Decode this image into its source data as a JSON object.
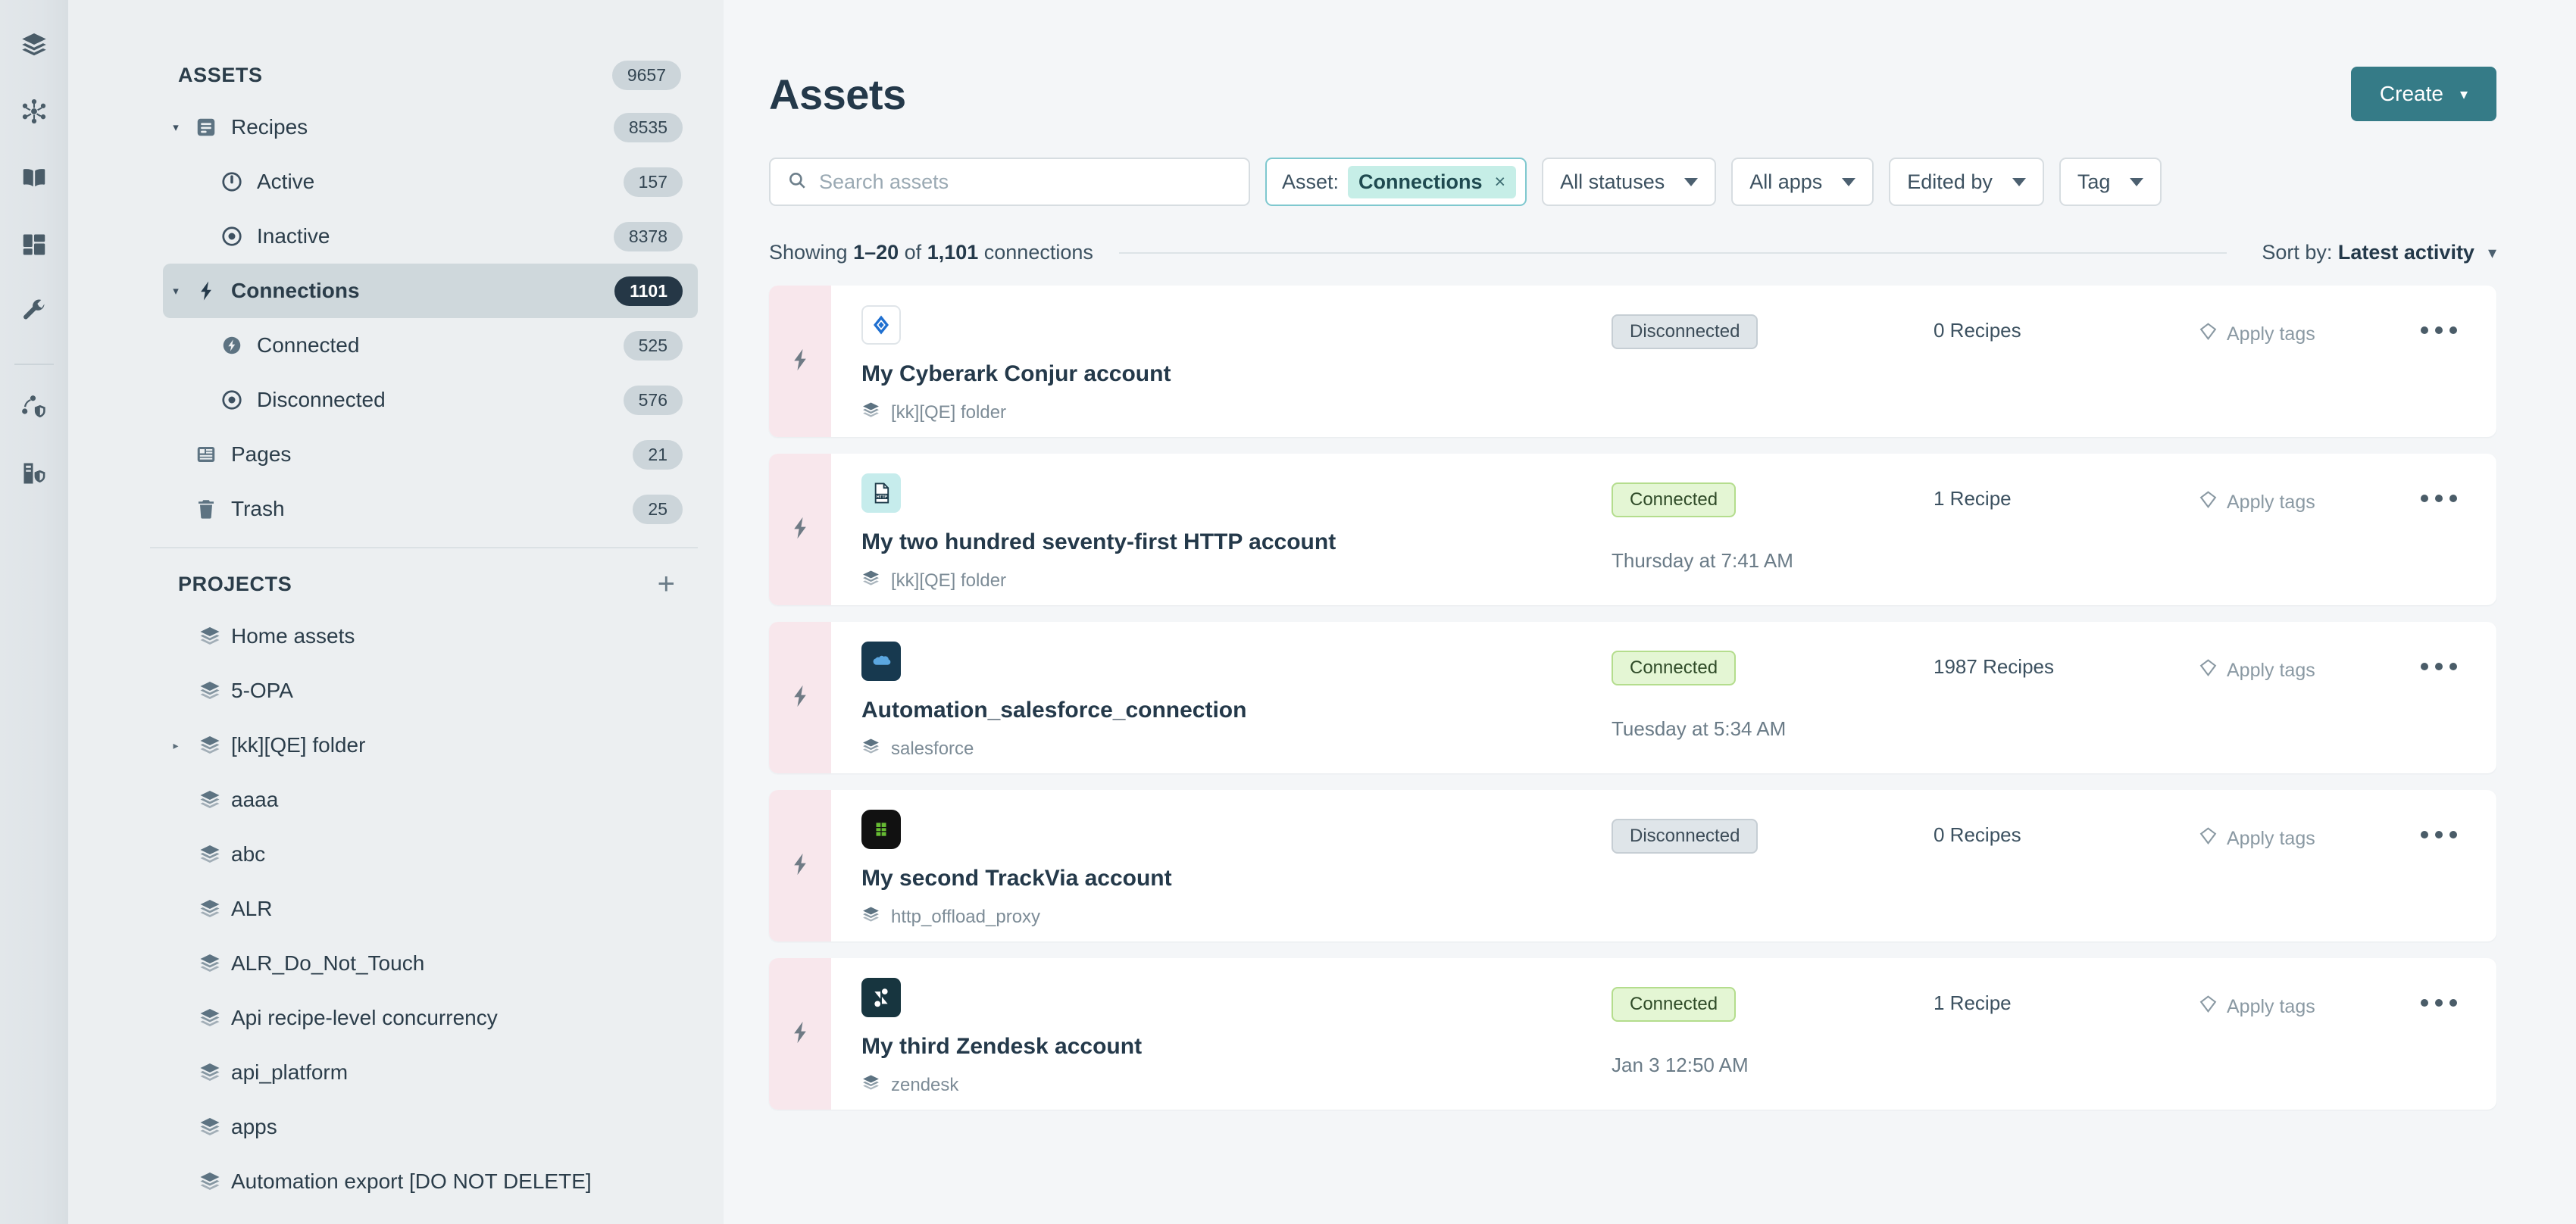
{
  "rail": {
    "items": [
      {
        "icon": "layers-icon",
        "name": "rail-item-assets"
      },
      {
        "icon": "hub-network-icon",
        "name": "rail-item-platform"
      },
      {
        "icon": "book-icon",
        "name": "rail-item-docs"
      },
      {
        "icon": "dashboard-icon",
        "name": "rail-item-dashboard"
      },
      {
        "icon": "wrench-icon",
        "name": "rail-item-tools"
      },
      {
        "icon": "network-shield-icon",
        "name": "rail-item-network-security"
      },
      {
        "icon": "server-shield-icon",
        "name": "rail-item-server-security"
      }
    ]
  },
  "sidebar": {
    "assets": {
      "title": "ASSETS",
      "count": "9657",
      "items": [
        {
          "label": "Recipes",
          "count": "8535",
          "icon": "recipe-icon",
          "level": 1,
          "caret": "down",
          "active": false
        },
        {
          "label": "Active",
          "count": "157",
          "icon": "power-icon",
          "level": 2,
          "caret": "none",
          "active": false
        },
        {
          "label": "Inactive",
          "count": "8378",
          "icon": "inactive-icon",
          "level": 2,
          "caret": "none",
          "active": false
        },
        {
          "label": "Connections",
          "count": "1101",
          "icon": "bolt-icon",
          "level": 1,
          "caret": "down",
          "active": true
        },
        {
          "label": "Connected",
          "count": "525",
          "icon": "bolt-circle-icon",
          "level": 2,
          "caret": "none",
          "active": false
        },
        {
          "label": "Disconnected",
          "count": "576",
          "icon": "inactive-icon",
          "level": 2,
          "caret": "none",
          "active": false
        },
        {
          "label": "Pages",
          "count": "21",
          "icon": "pages-icon",
          "level": 1,
          "caret": "none",
          "active": false
        },
        {
          "label": "Trash",
          "count": "25",
          "icon": "trash-icon",
          "level": 1,
          "caret": "none",
          "active": false
        }
      ]
    },
    "projects": {
      "title": "PROJECTS",
      "add_label": "+",
      "items": [
        {
          "label": "Home assets",
          "caret": false
        },
        {
          "label": "5-OPA",
          "caret": false
        },
        {
          "label": "[kk][QE] folder",
          "caret": true
        },
        {
          "label": "aaaa",
          "caret": false
        },
        {
          "label": "abc",
          "caret": false
        },
        {
          "label": "ALR",
          "caret": false
        },
        {
          "label": "ALR_Do_Not_Touch",
          "caret": false
        },
        {
          "label": "Api recipe-level concurrency",
          "caret": false
        },
        {
          "label": "api_platform",
          "caret": false
        },
        {
          "label": "apps",
          "caret": false
        },
        {
          "label": "Automation export [DO NOT DELETE]",
          "caret": false
        }
      ]
    }
  },
  "main": {
    "page_title": "Assets",
    "create_button": "Create",
    "search": {
      "placeholder": "Search assets",
      "value": ""
    },
    "asset_filter": {
      "label": "Asset:",
      "value": "Connections",
      "remove": "×"
    },
    "dropdowns": [
      {
        "label": "All statuses",
        "name": "all-statuses-filter"
      },
      {
        "label": "All apps",
        "name": "all-apps-filter"
      },
      {
        "label": "Edited by",
        "name": "edited-by-filter"
      },
      {
        "label": "Tag",
        "name": "tag-filter"
      }
    ],
    "showing": {
      "prefix": "Showing ",
      "range": "1–20",
      "mid": " of ",
      "total": "1,101",
      "suffix": " connections"
    },
    "sort": {
      "label": "Sort by: ",
      "value": "Latest activity"
    },
    "accent_color": "#357b87",
    "cards": [
      {
        "name": "My Cyberark Conjur account",
        "folder": "[kk][QE] folder",
        "status": "Disconnected",
        "status_type": "disconnected",
        "recipes": "0 Recipes",
        "time": "",
        "tags": "Apply tags",
        "app_icon": "cyberark-conjur-icon",
        "icon_bg": "#ffffff",
        "icon_fg": "#1f6fd0",
        "icon_text": ""
      },
      {
        "name": "My two hundred seventy-first HTTP account",
        "folder": "[kk][QE] folder",
        "status": "Connected",
        "status_type": "connected",
        "recipes": "1 Recipe",
        "time": "Thursday at 7:41 AM",
        "tags": "Apply tags",
        "app_icon": "http-icon",
        "icon_bg": "#c6ecec",
        "icon_fg": "#1d3b4a",
        "icon_text": "HTTP"
      },
      {
        "name": "Automation_salesforce_connection",
        "folder": "salesforce",
        "status": "Connected",
        "status_type": "connected",
        "recipes": "1987 Recipes",
        "time": "Tuesday at 5:34 AM",
        "tags": "Apply tags",
        "app_icon": "salesforce-icon",
        "icon_bg": "#17394f",
        "icon_fg": "#5ba7e0",
        "icon_text": ""
      },
      {
        "name": "My second TrackVia account",
        "folder": "http_offload_proxy",
        "status": "Disconnected",
        "status_type": "disconnected",
        "recipes": "0 Recipes",
        "time": "",
        "tags": "Apply tags",
        "app_icon": "trackvia-icon",
        "icon_bg": "#111111",
        "icon_fg": "#66bb33",
        "icon_text": ""
      },
      {
        "name": "My third Zendesk account",
        "folder": "zendesk",
        "status": "Connected",
        "status_type": "connected",
        "recipes": "1 Recipe",
        "time": "Jan 3 12:50 AM",
        "tags": "Apply tags",
        "app_icon": "zendesk-icon",
        "icon_bg": "#17353f",
        "icon_fg": "#ffffff",
        "icon_text": "Z"
      }
    ]
  }
}
